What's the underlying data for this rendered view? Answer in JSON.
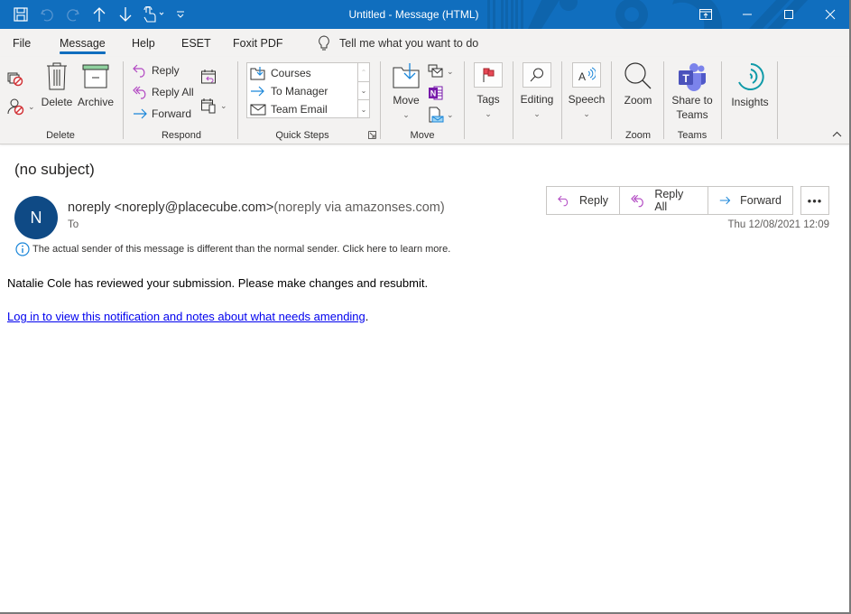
{
  "window": {
    "title": "Untitled  -  Message (HTML)",
    "accent": "#106ebe"
  },
  "qat": {
    "items": [
      {
        "icon": "save-icon"
      },
      {
        "icon": "undo-icon"
      },
      {
        "icon": "redo-icon"
      },
      {
        "icon": "previous-item-icon"
      },
      {
        "icon": "next-item-icon"
      },
      {
        "icon": "touch-mode-icon"
      },
      {
        "icon": "customize-qat-icon"
      }
    ]
  },
  "tabs": [
    {
      "label": "File",
      "active": false
    },
    {
      "label": "Message",
      "active": true
    },
    {
      "label": "Help",
      "active": false
    },
    {
      "label": "ESET",
      "active": false
    },
    {
      "label": "Foxit PDF",
      "active": false
    }
  ],
  "tell_me": {
    "placeholder": "Tell me what you want to do"
  },
  "ribbon": {
    "groups": {
      "delete": {
        "label": "Delete",
        "buttons": {
          "delete": "Delete",
          "archive": "Archive"
        }
      },
      "respond": {
        "label": "Respond",
        "buttons": {
          "reply": "Reply",
          "reply_all": "Reply All",
          "forward": "Forward"
        }
      },
      "quick_steps": {
        "label": "Quick Steps",
        "items": [
          "Courses",
          "To Manager",
          "Team Email"
        ]
      },
      "move": {
        "label": "Move",
        "buttons": {
          "move": "Move"
        }
      },
      "tags": {
        "button": "Tags"
      },
      "editing": {
        "button": "Editing"
      },
      "speech": {
        "button": "Speech"
      },
      "zoom": {
        "label": "Zoom",
        "button": "Zoom"
      },
      "teams": {
        "label": "Teams",
        "button_line1": "Share to",
        "button_line2": "Teams"
      },
      "insights": {
        "button": "Insights"
      }
    }
  },
  "message": {
    "subject": "(no subject)",
    "avatar_initial": "N",
    "avatar_color": "#0f4a85",
    "sender": "noreply <noreply@placecube.com>",
    "sender_via": "(noreply via amazonses.com)",
    "to_label": "To",
    "info_notice": "The actual sender of this message is different than the normal sender. Click here to learn more.",
    "actions": {
      "reply": "Reply",
      "reply_all": "Reply All",
      "forward": "Forward",
      "more": "•••"
    },
    "date": "Thu 12/08/2021 12:09",
    "body_line1": "Natalie Cole has reviewed your submission. Please make changes and resubmit.",
    "body_link": "Log in to view this notification and notes about what needs amending",
    "body_link_suffix": "."
  }
}
